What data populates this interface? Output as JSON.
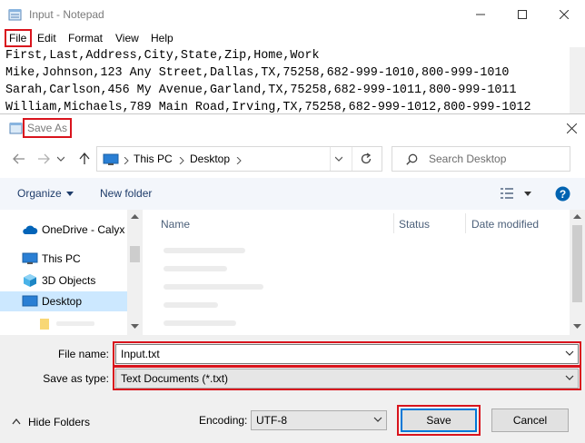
{
  "notepad": {
    "title": "Input - Notepad",
    "menu": [
      "File",
      "Edit",
      "Format",
      "View",
      "Help"
    ],
    "lines": [
      "First,Last,Address,City,State,Zip,Home,Work",
      "Mike,Johnson,123 Any Street,Dallas,TX,75258,682-999-1010,800-999-1010",
      "Sarah,Carlson,456 My Avenue,Garland,TX,75258,682-999-1011,800-999-1011",
      "William,Michaels,789 Main Road,Irving,TX,75258,682-999-1012,800-999-1012"
    ]
  },
  "dialog": {
    "title": "Save As",
    "breadcrumb": [
      "This PC",
      "Desktop"
    ],
    "search_placeholder": "Search Desktop",
    "toolbar": {
      "organize": "Organize",
      "new_folder": "New folder"
    },
    "nav_items": [
      {
        "label": "OneDrive - Calyx S",
        "icon": "onedrive-cloud-icon"
      },
      {
        "label": "This PC",
        "icon": "computer-icon"
      },
      {
        "label": "3D Objects",
        "icon": "3d-objects-icon"
      },
      {
        "label": "Desktop",
        "icon": "desktop-icon",
        "selected": true
      }
    ],
    "columns": [
      "Name",
      "Status",
      "Date modified"
    ],
    "file_name_label": "File name:",
    "file_name_value": "Input.txt",
    "save_type_label": "Save as type:",
    "save_type_value": "Text Documents (*.txt)",
    "hide_folders": "Hide Folders",
    "encoding_label": "Encoding:",
    "encoding_value": "UTF-8",
    "save_button": "Save",
    "cancel_button": "Cancel"
  },
  "colors": {
    "highlight_box": "#d9141d",
    "selection": "#cce8ff",
    "onedrive_blue": "#0364b8",
    "help_blue": "#0063b1"
  }
}
